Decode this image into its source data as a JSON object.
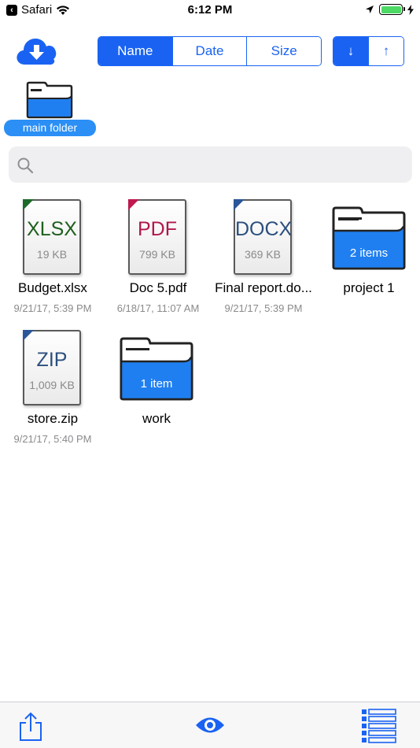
{
  "status_bar": {
    "back_app": "Safari",
    "time": "6:12 PM",
    "battery_color": "#4cd964"
  },
  "toolbar": {
    "cloud_icon": "cloud-download-icon",
    "sort_options": [
      {
        "label": "Name",
        "selected": true
      },
      {
        "label": "Date",
        "selected": false
      },
      {
        "label": "Size",
        "selected": false
      }
    ],
    "order_descending": "↓",
    "order_ascending": "↑",
    "accent_color": "#1a63f2"
  },
  "breadcrumb": {
    "current_folder": "main folder"
  },
  "search": {
    "placeholder": "",
    "value": ""
  },
  "items": [
    {
      "kind": "file",
      "ext": "XLSX",
      "size": "19 KB",
      "name": "Budget.xlsx",
      "date": "9/21/17, 5:39 PM",
      "ext_color": "#1d5f1d",
      "corner_color": "#1d6b2a"
    },
    {
      "kind": "file",
      "ext": "PDF",
      "size": "799 KB",
      "name": "Doc 5.pdf",
      "date": "6/18/17, 11:07 AM",
      "ext_color": "#b0184a",
      "corner_color": "#c0184f"
    },
    {
      "kind": "file",
      "ext": "DOCX",
      "size": "369 KB",
      "name": "Final report.do...",
      "date": "9/21/17, 5:39 PM",
      "ext_color": "#2b4f7e",
      "corner_color": "#2a5699"
    },
    {
      "kind": "folder",
      "count": "2 items",
      "name": "project 1",
      "date": ""
    },
    {
      "kind": "file",
      "ext": "ZIP",
      "size": "1,009 KB",
      "name": "store.zip",
      "date": "9/21/17, 5:40 PM",
      "ext_color": "#2b4f7e",
      "corner_color": "#2a5699"
    },
    {
      "kind": "folder",
      "count": "1 item",
      "name": "work",
      "date": ""
    }
  ],
  "bottom_bar": {
    "share_icon": "share-icon",
    "eye_icon": "eye-icon",
    "list_icon": "list-view-icon"
  }
}
